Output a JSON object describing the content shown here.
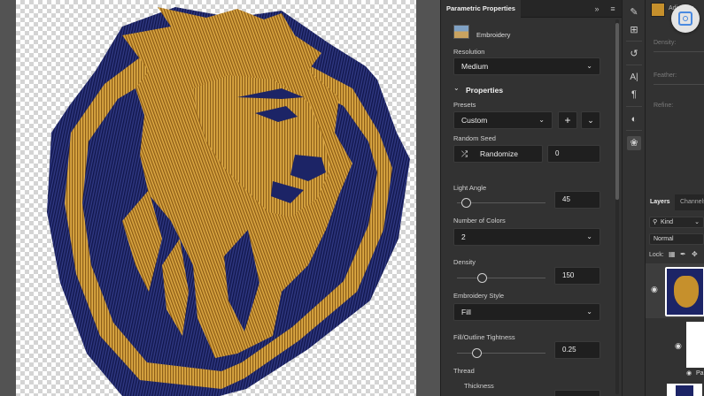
{
  "panel": {
    "title": "Parametric Properties",
    "effect_name": "Embroidery",
    "resolution_label": "Resolution",
    "resolution_value": "Medium",
    "properties_title": "Properties",
    "presets_label": "Presets",
    "presets_value": "Custom",
    "random_seed_label": "Random Seed",
    "randomize_label": "Randomize",
    "random_seed_value": "0",
    "light_angle_label": "Light Angle",
    "light_angle_value": "45",
    "number_of_colors_label": "Number of Colors",
    "number_of_colors_value": "2",
    "density_label": "Density",
    "density_value": "150",
    "embroidery_style_label": "Embroidery Style",
    "embroidery_style_value": "Fill",
    "tightness_label": "Fill/Outline Tightness",
    "tightness_value": "0.25",
    "thread_label": "Thread",
    "thickness_label": "Thickness"
  },
  "sliders": {
    "light_angle_fraction": 0.1,
    "density_fraction": 0.28,
    "tightness_fraction": 0.22
  },
  "right_panel": {
    "top_label": "Adjust se",
    "density_label": "Density:",
    "feather_label": "Feather:",
    "refine_label": "Refine:",
    "layers_tab": "Layers",
    "channels_tab": "Channels",
    "kind_filter": "Kind",
    "blend_mode": "Normal",
    "lock_label": "Lock:",
    "layer_name_fragment": "Pa"
  },
  "colors": {
    "navy": "#1c2466",
    "gold": "#c6902c",
    "panel_bg": "#323232",
    "field_bg": "#1f1f1f"
  }
}
